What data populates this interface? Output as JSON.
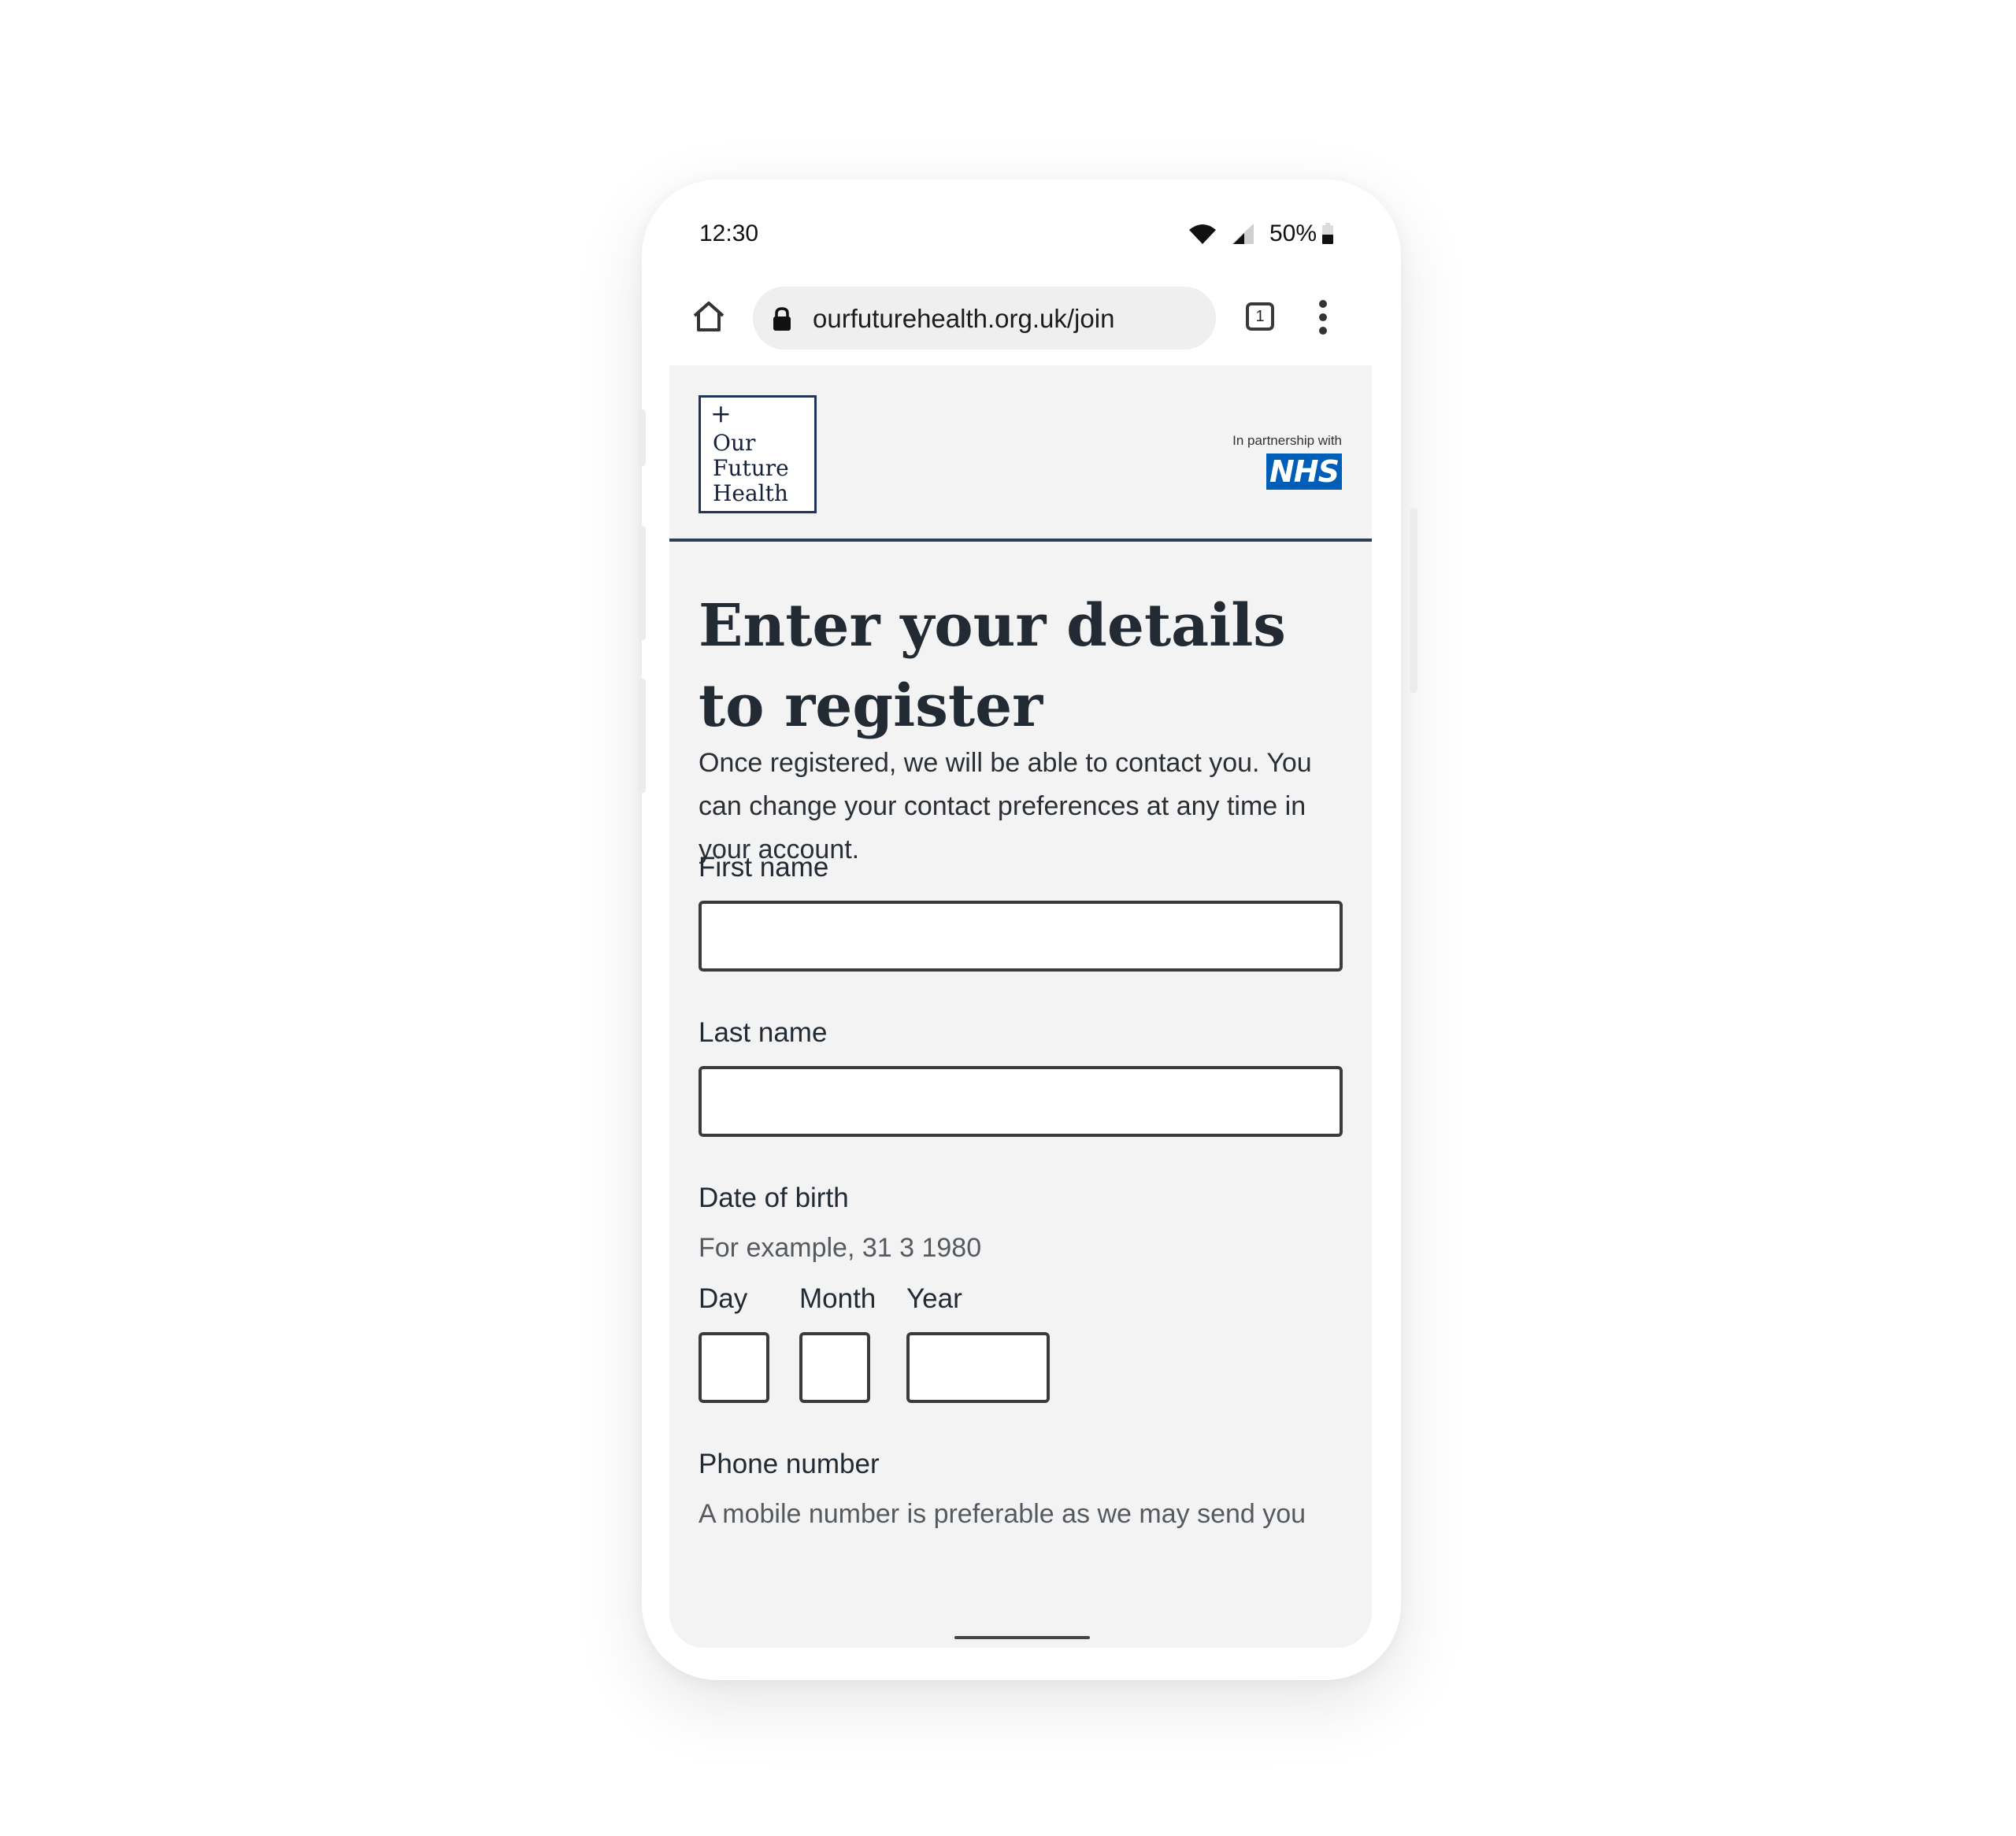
{
  "status_bar": {
    "time": "12:30",
    "battery": "50%"
  },
  "browser": {
    "url": "ourfuturehealth.org.uk/join",
    "tab_count": "1"
  },
  "header": {
    "logo_plus": "+",
    "logo_line1": "Our",
    "logo_line2": "Future",
    "logo_line3": "Health",
    "partner_text": "In partnership with",
    "nhs_logo": "NHS",
    "nhs_color": "#005eb8"
  },
  "form": {
    "title": "Enter your details to register",
    "intro": "Once registered, we will be able to contact you. You can change your contact preferences at any time in your account.",
    "first_name_label": "First name",
    "last_name_label": "Last name",
    "dob_label": "Date of birth",
    "dob_hint": "For example, 31 3 1980",
    "day_label": "Day",
    "month_label": "Month",
    "year_label": "Year",
    "phone_label": "Phone number",
    "phone_hint": "A mobile number is preferable as we may send you"
  }
}
